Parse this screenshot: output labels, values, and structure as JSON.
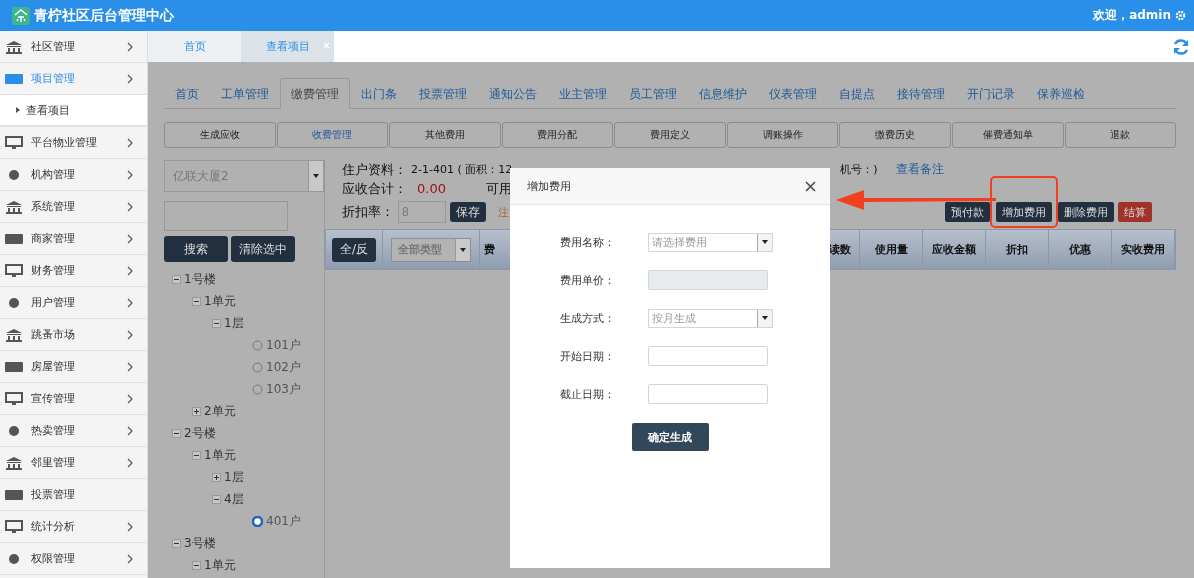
{
  "header": {
    "title": "青柠社区后台管理中心",
    "welcome": "欢迎，admin"
  },
  "sidebar": {
    "items": [
      {
        "label": "社区管理",
        "selected": false,
        "expandable": true
      },
      {
        "label": "项目管理",
        "selected": true,
        "expandable": true,
        "children": [
          {
            "label": "查看项目"
          }
        ]
      },
      {
        "label": "平台物业管理",
        "selected": false,
        "expandable": true
      },
      {
        "label": "机构管理",
        "selected": false,
        "expandable": true
      },
      {
        "label": "系统管理",
        "selected": false,
        "expandable": true
      },
      {
        "label": "商家管理",
        "selected": false,
        "expandable": true
      },
      {
        "label": "财务管理",
        "selected": false,
        "expandable": true
      },
      {
        "label": "用户管理",
        "selected": false,
        "expandable": true
      },
      {
        "label": "跳蚤市场",
        "selected": false,
        "expandable": true
      },
      {
        "label": "房屋管理",
        "selected": false,
        "expandable": true
      },
      {
        "label": "宣传管理",
        "selected": false,
        "expandable": true
      },
      {
        "label": "热卖管理",
        "selected": false,
        "expandable": true
      },
      {
        "label": "邻里管理",
        "selected": false,
        "expandable": true
      },
      {
        "label": "投票管理",
        "selected": false,
        "expandable": false
      },
      {
        "label": "统计分析",
        "selected": false,
        "expandable": true
      },
      {
        "label": "权限管理",
        "selected": false,
        "expandable": true
      }
    ]
  },
  "page_tabs": [
    {
      "label": "首页",
      "selected": false,
      "closable": false
    },
    {
      "label": "查看项目",
      "selected": true,
      "closable": true
    }
  ],
  "module_tabs": [
    {
      "label": "首页",
      "selected": false
    },
    {
      "label": "工单管理",
      "selected": false
    },
    {
      "label": "缴费管理",
      "selected": true
    },
    {
      "label": "出门条",
      "selected": false
    },
    {
      "label": "投票管理",
      "selected": false
    },
    {
      "label": "通知公告",
      "selected": false
    },
    {
      "label": "业主管理",
      "selected": false
    },
    {
      "label": "员工管理",
      "selected": false
    },
    {
      "label": "信息维护",
      "selected": false
    },
    {
      "label": "仪表管理",
      "selected": false
    },
    {
      "label": "自提点",
      "selected": false
    },
    {
      "label": "接待管理",
      "selected": false
    },
    {
      "label": "开门记录",
      "selected": false
    },
    {
      "label": "保养巡检",
      "selected": false
    }
  ],
  "sub_tabs": [
    {
      "label": "生成应收",
      "selected": false
    },
    {
      "label": "收费管理",
      "selected": true
    },
    {
      "label": "其他费用",
      "selected": false
    },
    {
      "label": "费用分配",
      "selected": false
    },
    {
      "label": "费用定义",
      "selected": false
    },
    {
      "label": "调账操作",
      "selected": false
    },
    {
      "label": "缴费历史",
      "selected": false
    },
    {
      "label": "催费通知单",
      "selected": false
    },
    {
      "label": "退款",
      "selected": false
    }
  ],
  "left_panel": {
    "building_select": "亿联大厦2",
    "search_button": "搜索",
    "clear_button": "清除选中",
    "tree": [
      {
        "label": "1号楼",
        "kind": "group",
        "expanded": true,
        "children": [
          {
            "label": "1单元",
            "kind": "group",
            "expanded": true,
            "children": [
              {
                "label": "1层",
                "kind": "group",
                "expanded": true,
                "children": [
                  {
                    "label": "101户",
                    "kind": "leaf",
                    "selected": false
                  },
                  {
                    "label": "102户",
                    "kind": "leaf",
                    "selected": false
                  },
                  {
                    "label": "103户",
                    "kind": "leaf",
                    "selected": false
                  }
                ]
              }
            ]
          },
          {
            "label": "2单元",
            "kind": "group",
            "expanded": false
          }
        ]
      },
      {
        "label": "2号楼",
        "kind": "group",
        "expanded": true,
        "children": [
          {
            "label": "1单元",
            "kind": "group",
            "expanded": true,
            "children": [
              {
                "label": "1层",
                "kind": "group",
                "expanded": false
              },
              {
                "label": "4层",
                "kind": "group",
                "expanded": true,
                "children": [
                  {
                    "label": "401户",
                    "kind": "leaf",
                    "selected": true
                  }
                ]
              }
            ]
          }
        ]
      },
      {
        "label": "3号楼",
        "kind": "group",
        "expanded": true,
        "children": [
          {
            "label": "1单元",
            "kind": "group",
            "expanded": true
          }
        ]
      }
    ]
  },
  "resident": {
    "info_label": "住户资料：",
    "info_value": "2-1-401 ( 面积：12",
    "info_tail": "机号：)",
    "notes_link": "查看备注",
    "total_label": "应收合计：",
    "total_value": "0.00",
    "balance_label": "可用",
    "discount_label": "折扣率：",
    "discount_value": "8",
    "save_button": "保存",
    "note_text": "注"
  },
  "actions": [
    {
      "label": "预付款",
      "kind": "normal",
      "highlighted": false
    },
    {
      "label": "增加费用",
      "kind": "normal",
      "highlighted": true
    },
    {
      "label": "删除费用",
      "kind": "normal",
      "highlighted": false
    },
    {
      "label": "结算",
      "kind": "danger",
      "highlighted": false
    }
  ],
  "table": {
    "select_all": "全/反",
    "type_filter": "全部类型",
    "columns": [
      "费",
      "读数",
      "使用量",
      "应收金额",
      "折扣",
      "优惠",
      "实收费用"
    ]
  },
  "dialog": {
    "title": "增加费用",
    "fields": [
      {
        "label": "费用名称：",
        "kind": "select",
        "placeholder": "请选择费用"
      },
      {
        "label": "费用单价：",
        "kind": "disabled"
      },
      {
        "label": "生成方式：",
        "kind": "select",
        "placeholder": "按月生成"
      },
      {
        "label": "开始日期：",
        "kind": "input"
      },
      {
        "label": "截止日期：",
        "kind": "input"
      }
    ],
    "submit": "确定生成"
  }
}
